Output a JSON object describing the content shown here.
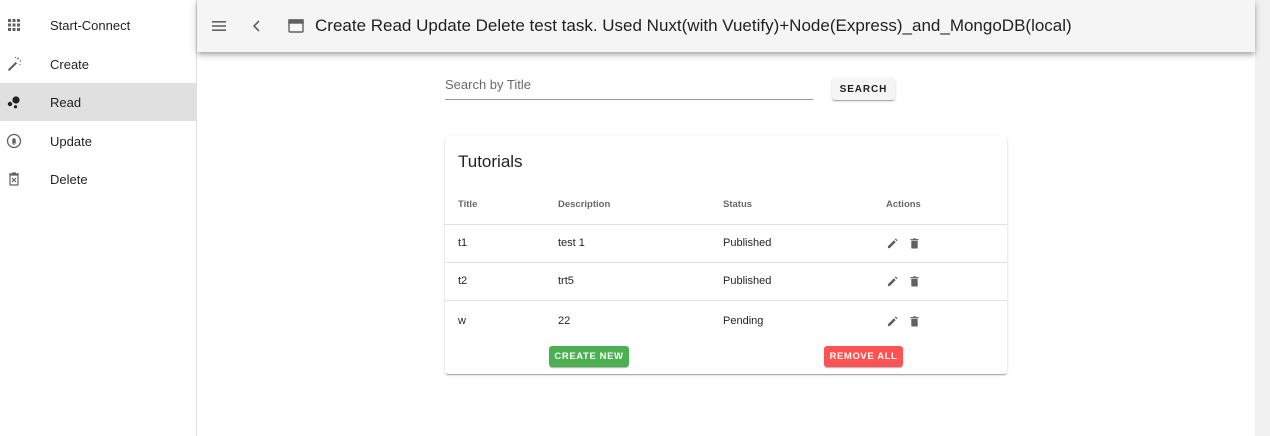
{
  "sidebar": {
    "items": [
      {
        "label": "Start-Connect",
        "icon": "apps-grid-icon"
      },
      {
        "label": "Create",
        "icon": "magic-wand-icon"
      },
      {
        "label": "Read",
        "icon": "bubble-chart-icon",
        "active": true
      },
      {
        "label": "Update",
        "icon": "bell-circle-icon"
      },
      {
        "label": "Delete",
        "icon": "trash-x-icon"
      }
    ]
  },
  "appbar": {
    "title": "Create Read Update Delete test task. Used Nuxt(with Vuetify)+Node(Express)_and_MongoDB(local)"
  },
  "search": {
    "placeholder": "Search by Title",
    "value": "",
    "button_label": "SEARCH"
  },
  "card": {
    "title": "Tutorials",
    "headers": {
      "title": "Title",
      "description": "Description",
      "status": "Status",
      "actions": "Actions"
    },
    "rows": [
      {
        "title": "t1",
        "description": "test 1",
        "status": "Published"
      },
      {
        "title": "t2",
        "description": "trt5",
        "status": "Published"
      },
      {
        "title": "w",
        "description": "22",
        "status": "Pending"
      }
    ],
    "create_label": "CREATE NEW",
    "remove_label": "REMOVE ALL"
  },
  "colors": {
    "create": "#4caf50",
    "remove": "#ff5252",
    "appbar": "#f5f5f5",
    "active_nav": "#e0e0e0"
  }
}
